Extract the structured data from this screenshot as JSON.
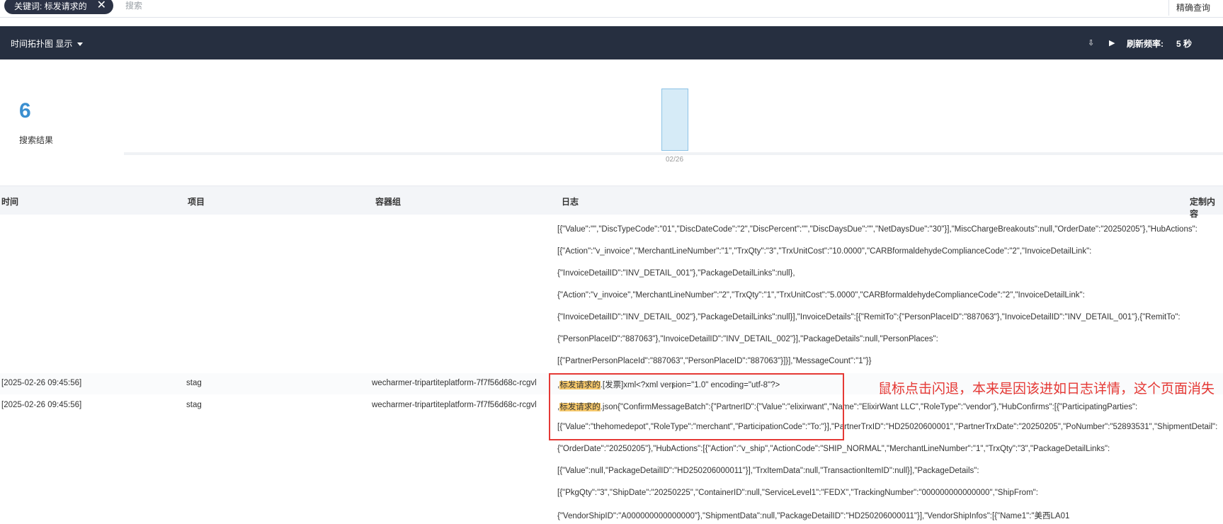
{
  "search": {
    "chip_label": "关键词: 标发请求的",
    "placeholder": "搜索",
    "exact_label": "精确查询"
  },
  "toolbar": {
    "view_label": "时间拓扑图 显示",
    "refresh_label": "刷新频率:",
    "refresh_value": "5 秒"
  },
  "summary": {
    "count": "6",
    "count_label": "搜索结果",
    "tick": "02/26"
  },
  "table": {
    "headers": [
      "时间",
      "项目",
      "容器组",
      "日志",
      "定制内容"
    ]
  },
  "log_before": [
    "[{\"Value\":\"\",\"DiscTypeCode\":\"01\",\"DiscDateCode\":\"2\",\"DiscPercent\":\"\",\"DiscDaysDue\":\"\",\"NetDaysDue\":\"30\"}],\"MiscChargeBreakouts\":null,\"OrderDate\":\"20250205\"},\"HubActions\":",
    "[{\"Action\":\"v_invoice\",\"MerchantLineNumber\":\"1\",\"TrxQty\":\"3\",\"TrxUnitCost\":\"10.0000\",\"CARBformaldehydeComplianceCode\":\"2\",\"InvoiceDetailLink\":",
    "{\"InvoiceDetailID\":\"INV_DETAIL_001\"},\"PackageDetailLinks\":null},",
    "{\"Action\":\"v_invoice\",\"MerchantLineNumber\":\"2\",\"TrxQty\":\"1\",\"TrxUnitCost\":\"5.0000\",\"CARBformaldehydeComplianceCode\":\"2\",\"InvoiceDetailLink\":",
    "{\"InvoiceDetailID\":\"INV_DETAIL_002\"},\"PackageDetailLinks\":null}],\"InvoiceDetails\":[{\"RemitTo\":{\"PersonPlaceID\":\"887063\"},\"InvoiceDetailID\":\"INV_DETAIL_001\"},{\"RemitTo\":",
    "{\"PersonPlaceID\":\"887063\"},\"InvoiceDetailID\":\"INV_DETAIL_002\"}],\"PackageDetails\":null,\"PersonPlaces\":",
    "[{\"PartnerPersonPlaceId\":\"887063\",\"PersonPlaceID\":\"887063\"}]}],\"MessageCount\":\"1\"}}"
  ],
  "rows": [
    {
      "time": "[2025-02-26 09:45:56]",
      "project": "stag",
      "pod": "wecharmer-tripartiteplatform-7f7f56d68c-rcgvl",
      "highlight": "标发请求的",
      "prefix": ",",
      "rest": ".[发票]xml<?xml version=\"1.0\" encoding=\"utf-8\"?>"
    },
    {
      "time": "[2025-02-26 09:45:56]",
      "project": "stag",
      "pod": "wecharmer-tripartiteplatform-7f7f56d68c-rcgvl",
      "highlight": "标发请求的",
      "prefix": ",",
      "rest": ".json{\"ConfirmMessageBatch\":{\"PartnerID\":{\"Value\":\"elixirwant\",\"Name\":\"ElixirWant LLC\",\"RoleType\":\"vendor\"},\"HubConfirms\":[{\"ParticipatingParties\":"
    }
  ],
  "log_after": [
    "[{\"Value\":\"thehomedepot\",\"RoleType\":\"merchant\",\"ParticipationCode\":\"To:\"}],\"PartnerTrxID\":\"HD25020600001\",\"PartnerTrxDate\":\"20250205\",\"PoNumber\":\"52893531\",\"ShipmentDetail\":",
    "{\"OrderDate\":\"20250205\"},\"HubActions\":[{\"Action\":\"v_ship\",\"ActionCode\":\"SHIP_NORMAL\",\"MerchantLineNumber\":\"1\",\"TrxQty\":\"3\",\"PackageDetailLinks\":",
    "[{\"Value\":null,\"PackageDetailID\":\"HD250206000011\"}],\"TrxItemData\":null,\"TransactionItemID\":null}],\"PackageDetails\":",
    "[{\"PkgQty\":\"3\",\"ShipDate\":\"20250225\",\"ContainerID\":null,\"ServiceLevel1\":\"FEDX\",\"TrackingNumber\":\"000000000000000\",\"ShipFrom\":",
    "{\"VendorShipID\":\"A000000000000000\"},\"ShipmentData\":null,\"PackageDetailID\":\"HD250206000011\"}],\"VendorShipInfos\":[{\"Name1\":\"美西LA01"
  ],
  "annotation": "鼠标点击闪退，本来是因该进如日志详情，这个页面消失"
}
